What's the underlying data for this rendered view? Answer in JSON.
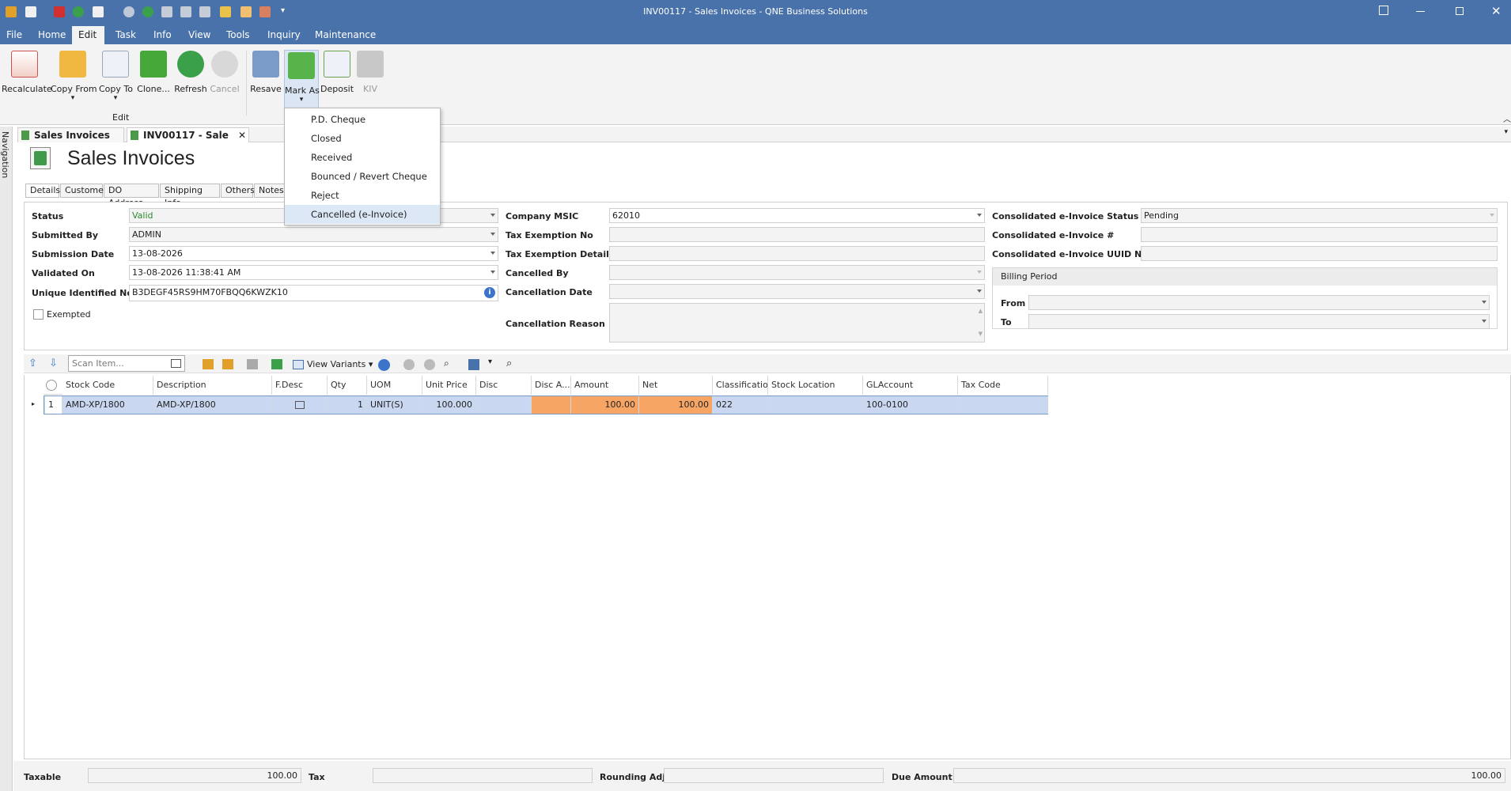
{
  "window": {
    "title": "INV00117 - Sales Invoices - QNE Business Solutions"
  },
  "menu": [
    "File",
    "Home",
    "Edit",
    "Task",
    "Info",
    "View",
    "Tools",
    "Inquiry",
    "Maintenance"
  ],
  "ribbon": {
    "buttons": [
      {
        "label": "Recalculate",
        "icon": "recalculate-icon"
      },
      {
        "label": "Copy From",
        "icon": "copy-from-icon"
      },
      {
        "label": "Copy To",
        "icon": "copy-to-icon"
      },
      {
        "label": "Clone...",
        "icon": "clone-icon"
      },
      {
        "label": "Refresh",
        "icon": "refresh-icon"
      },
      {
        "label": "Cancel",
        "icon": "cancel-icon"
      },
      {
        "label": "Resave",
        "icon": "resave-icon"
      },
      {
        "label": "Mark As",
        "icon": "mark-as-icon"
      },
      {
        "label": "Deposit",
        "icon": "deposit-icon"
      },
      {
        "label": "KIV",
        "icon": "kiv-icon"
      }
    ],
    "group_label": "Edit"
  },
  "mark_as_menu": [
    "P.D. Cheque",
    "Closed",
    "Received",
    "Bounced / Revert Cheque",
    "Reject",
    "Cancelled (e-Invoice)"
  ],
  "nav_label": "Navigation",
  "doc_tabs": [
    "Sales Invoices",
    "INV00117 - Sale"
  ],
  "page_title": "Sales Invoices",
  "sub_tabs": [
    "Details",
    "Customer",
    "DO Address",
    "Shipping Info",
    "Others",
    "Notes"
  ],
  "form": {
    "status": {
      "label": "Status",
      "value": "Valid"
    },
    "submitted_by": {
      "label": "Submitted By",
      "value": "ADMIN"
    },
    "submission_date": {
      "label": "Submission Date",
      "value": "13-08-2026"
    },
    "validated_on": {
      "label": "Validated On",
      "value": "13-08-2026 11:38:41 AM"
    },
    "uin": {
      "label": "Unique Identified No.",
      "value": "B3DEGF45RS9HM70FBQQ6KWZK10"
    },
    "exempted": {
      "label": "Exempted"
    },
    "company_msic": {
      "label": "Company MSIC",
      "value": "62010"
    },
    "tax_exemption_no": {
      "label": "Tax Exemption No",
      "value": ""
    },
    "tax_exemption_details": {
      "label": "Tax Exemption Details",
      "value": ""
    },
    "cancelled_by": {
      "label": "Cancelled By",
      "value": ""
    },
    "cancellation_date": {
      "label": "Cancellation Date",
      "value": ""
    },
    "cancellation_reason": {
      "label": "Cancellation Reason",
      "value": ""
    },
    "consolidated_status": {
      "label": "Consolidated e-Invoice Status",
      "value": "Pending"
    },
    "consolidated_no": {
      "label": "Consolidated e-Invoice #",
      "value": ""
    },
    "consolidated_uuid": {
      "label": "Consolidated e-Invoice UUID No.",
      "value": ""
    },
    "billing_period": {
      "title": "Billing Period",
      "from_label": "From",
      "to_label": "To"
    }
  },
  "grid_toolbar": {
    "scan_placeholder": "Scan Item...",
    "view_variants": "View Variants"
  },
  "grid": {
    "columns": [
      "Stock Code",
      "Description",
      "F.Desc",
      "Qty",
      "UOM",
      "Unit Price",
      "Disc",
      "Disc A...",
      "Amount",
      "Net",
      "Classification",
      "Stock Location",
      "GLAccount",
      "Tax Code"
    ],
    "rows": [
      {
        "no": "1",
        "stock_code": "AMD-XP/1800",
        "description": "AMD-XP/1800",
        "qty": "1",
        "uom": "UNIT(S)",
        "unit_price": "100.000",
        "disc": "",
        "disc_amt": "",
        "amount": "100.00",
        "net": "100.00",
        "classification": "022",
        "stock_location": "",
        "gl_account": "100-0100",
        "tax_code": ""
      }
    ]
  },
  "footer": {
    "taxable_label": "Taxable",
    "taxable": "100.00",
    "tax_label": "Tax",
    "tax": "",
    "rounding_label": "Rounding Adj",
    "rounding": "",
    "due_label": "Due Amount",
    "due": "100.00"
  },
  "colors": {
    "titlebar": "#4a72aa",
    "selected_row": "#c9d8f0",
    "highlight_cell": "#f6a565",
    "valid_text": "#2a8a2a"
  }
}
